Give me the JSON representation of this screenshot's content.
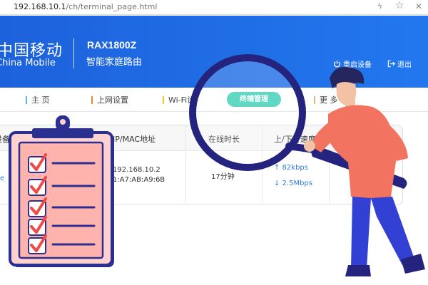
{
  "browser": {
    "url_host": "192.168.10.1",
    "url_path": "/ch/terminal_page.html"
  },
  "header": {
    "brand_cn": "中国移动",
    "brand_en": "China Mobile",
    "model": "RAX1800Z",
    "product": "智能家庭路由",
    "restart_label": "重启设备",
    "logout_label": "退出"
  },
  "nav": {
    "items": [
      {
        "label": "主 页",
        "color": "#4dbde0"
      },
      {
        "label": "上网设置",
        "color": "#f08a2c"
      },
      {
        "label": "Wi-Fi设",
        "color": "#f4c32c"
      },
      {
        "label": "终端管理",
        "active": true
      },
      {
        "label": "更 多",
        "color": "#d9b98a"
      }
    ],
    "active_color": "#3fd0b8"
  },
  "table": {
    "headers": [
      "设备",
      "IP/MAC地址",
      "在线时长",
      "上/下行速度",
      "间"
    ],
    "row": {
      "ip": "192.168.10.2",
      "mac": "1:A7:AB:A9:6B",
      "online": "17分钟",
      "up": "↑ 82kbps",
      "down": "↓ 2.5Mbps",
      "device_link": "e"
    }
  },
  "colors": {
    "header_blue": "#1f6ae4",
    "accent_teal": "#3fd0b8",
    "link_blue": "#2f7de0",
    "clipboard_border": "#2b2f8f",
    "check_red": "#ef4a45"
  }
}
